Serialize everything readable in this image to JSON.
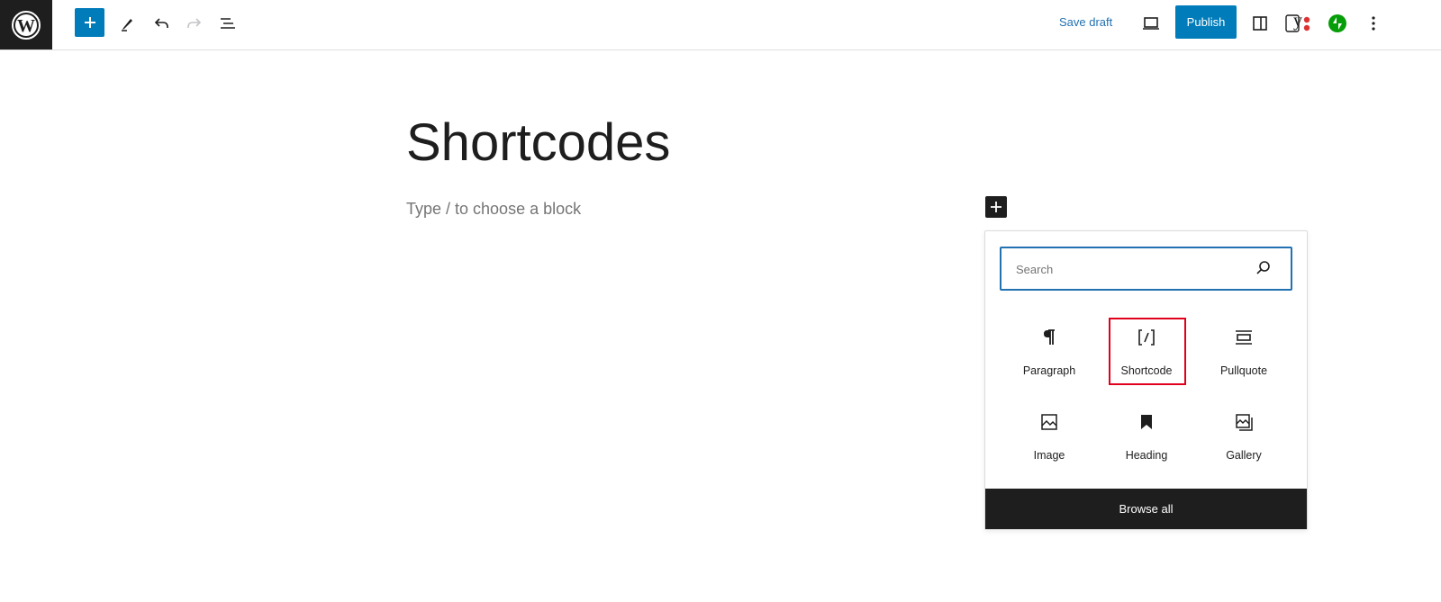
{
  "toolbar": {
    "save_draft_label": "Save draft",
    "publish_label": "Publish",
    "yoast_letter": "y"
  },
  "editor": {
    "title": "Shortcodes",
    "placeholder": "Type / to choose a block"
  },
  "inserter": {
    "search_placeholder": "Search",
    "blocks": [
      {
        "label": "Paragraph",
        "icon": "paragraph-icon"
      },
      {
        "label": "Shortcode",
        "icon": "shortcode-icon",
        "highlighted": true
      },
      {
        "label": "Pullquote",
        "icon": "pullquote-icon"
      },
      {
        "label": "Image",
        "icon": "image-icon"
      },
      {
        "label": "Heading",
        "icon": "heading-icon"
      },
      {
        "label": "Gallery",
        "icon": "gallery-icon"
      }
    ],
    "browse_all_label": "Browse all"
  },
  "colors": {
    "accent": "#007cba",
    "link": "#2271b1",
    "dark": "#1e1e1e",
    "highlight": "#e0001b",
    "jetpack_green": "#069e08"
  }
}
